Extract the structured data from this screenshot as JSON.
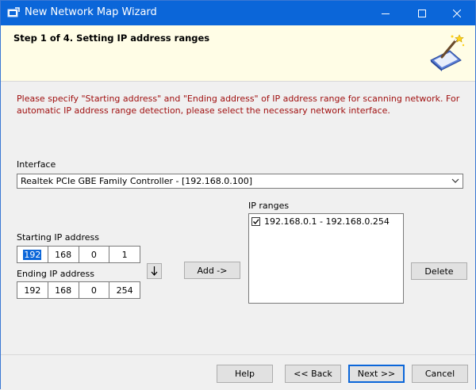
{
  "window": {
    "title": "New Network Map Wizard"
  },
  "header": {
    "step_title": "Step 1 of 4. Setting IP address ranges"
  },
  "instructions": "Please specify \"Starting address\" and \"Ending address\" of IP address range for scanning network. For automatic IP address range detection, please select the necessary network interface.",
  "interface": {
    "label": "Interface",
    "selected": "Realtek PCIe GBE Family Controller - [192.168.0.100]"
  },
  "starting_ip": {
    "label": "Starting IP address",
    "octets": [
      "192",
      "168",
      "0",
      "1"
    ]
  },
  "ending_ip": {
    "label": "Ending IP address",
    "octets": [
      "192",
      "168",
      "0",
      "254"
    ]
  },
  "add_button": "Add ->",
  "ip_ranges": {
    "label": "IP ranges",
    "items": [
      {
        "text": "192.168.0.1 - 192.168.0.254",
        "checked": true
      }
    ]
  },
  "delete_button": "Delete",
  "footer": {
    "help": "Help",
    "back": "<< Back",
    "next": "Next >>",
    "cancel": "Cancel"
  },
  "colors": {
    "titlebar": "#0b66d9",
    "header_bg": "#fffde6",
    "instructions_text": "#a01010"
  }
}
